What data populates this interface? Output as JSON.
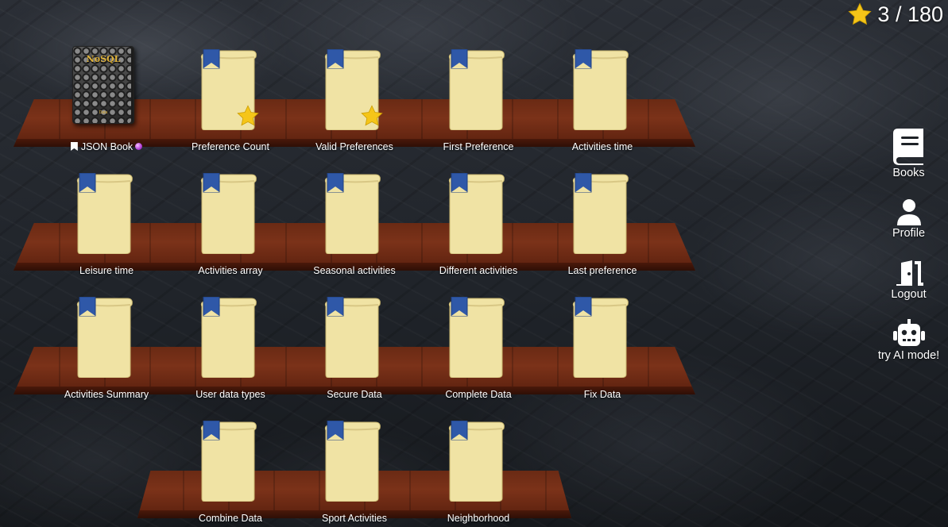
{
  "score": {
    "earned": "3",
    "separator": "/",
    "total": "180",
    "text": "3 / 180"
  },
  "colors": {
    "star": "#f5c518",
    "scroll_paper": "#f0e3a4",
    "bookmark": "#2f58a8",
    "shelf_wood": "#6a2a14",
    "book_title": "#e0b33a"
  },
  "book": {
    "cover_title": "NoSQL",
    "cover_footer": "Data",
    "label": "JSON Book"
  },
  "items": [
    {
      "label": "Preference Count",
      "starred": true
    },
    {
      "label": "Valid Preferences",
      "starred": true
    },
    {
      "label": "First Preference",
      "starred": false
    },
    {
      "label": "Activities time",
      "starred": false
    },
    {
      "label": "Leisure time",
      "starred": false
    },
    {
      "label": "Activities array",
      "starred": false
    },
    {
      "label": "Seasonal activities",
      "starred": false
    },
    {
      "label": "Different activities",
      "starred": false
    },
    {
      "label": "Last preference",
      "starred": false
    },
    {
      "label": "Activities Summary",
      "starred": false
    },
    {
      "label": "User data types",
      "starred": false
    },
    {
      "label": "Secure Data",
      "starred": false
    },
    {
      "label": "Complete Data",
      "starred": false
    },
    {
      "label": "Fix Data",
      "starred": false
    },
    {
      "label": "Combine Data",
      "starred": false
    },
    {
      "label": "Sport Activities",
      "starred": false
    },
    {
      "label": "Neighborhood",
      "starred": false
    }
  ],
  "nav": {
    "books": "Books",
    "profile": "Profile",
    "logout": "Logout",
    "ai_mode": "try AI mode!"
  },
  "icons": {
    "score": "star-icon",
    "books": "book-icon",
    "profile": "user-icon",
    "logout": "door-exit-icon",
    "ai_mode": "robot-icon",
    "scroll": "scroll-icon",
    "bookmark": "bookmark-icon",
    "ai_badge": "crystal-ball-icon"
  }
}
